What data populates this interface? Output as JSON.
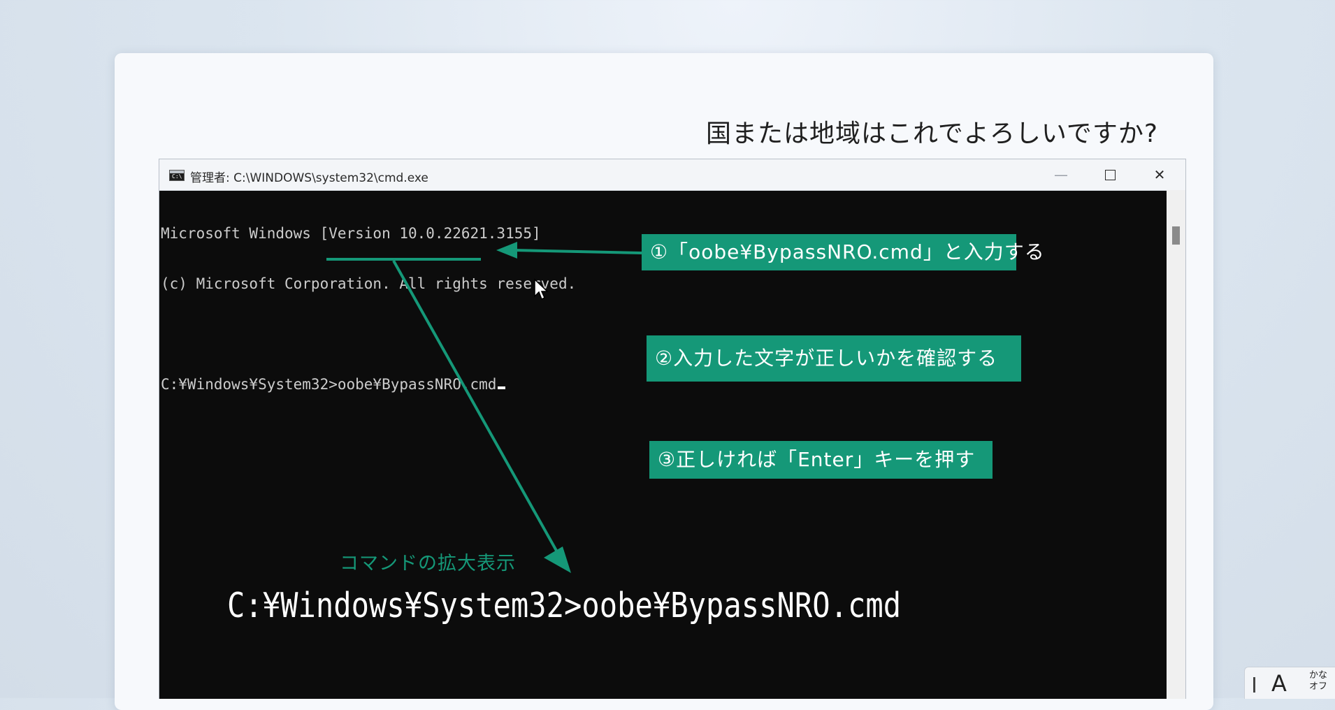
{
  "oobe": {
    "question": "国または地域はこれでよろしいですか?"
  },
  "cmd_window": {
    "title": "管理者: C:\\WINDOWS\\system32\\cmd.exe",
    "icon_label": "C:\\",
    "lines": [
      "Microsoft Windows [Version 10.0.22621.3155]",
      "(c) Microsoft Corporation. All rights reserved.",
      "",
      "C:¥Windows¥System32>oobe¥BypassNRO.cmd"
    ],
    "buttons": {
      "minimize": "—",
      "close": "✕"
    }
  },
  "annotations": {
    "callout_1": "①「oobe¥BypassNRO.cmd」と入力する",
    "callout_2": "②入力した文字が正しいかを確認する",
    "callout_3": "③正しければ「Enter」キーを押す",
    "zoom_label": "コマンドの拡大表示",
    "zoom_command": "C:¥Windows¥System32>oobe¥BypassNRO.cmd"
  },
  "ime": {
    "mode": "A",
    "kana_top": "かな",
    "kana_bottom": "オフ"
  },
  "colors": {
    "accent": "#159878",
    "console_bg": "#0c0c0c",
    "console_text": "#cccccc"
  },
  "icons": {
    "app": "cmd-icon",
    "minimize": "minimize-icon",
    "maximize": "maximize-icon",
    "close": "close-icon",
    "pointer": "mouse-pointer-icon"
  }
}
